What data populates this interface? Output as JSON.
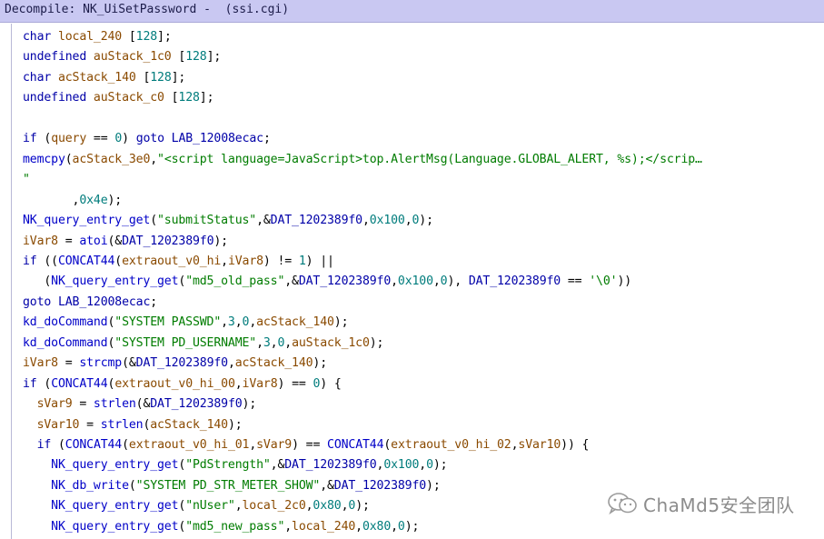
{
  "window": {
    "title": "Decompile: NK_UiSetPassword -  (ssi.cgi)"
  },
  "code": {
    "lines": [
      "char local_240 [128];",
      "undefined auStack_1c0 [128];",
      "char acStack_140 [128];",
      "undefined auStack_c0 [128];",
      "",
      "if (query == 0) goto LAB_12008ecac;",
      "memcpy(acStack_3e0,\"<script language=JavaScript>top.AlertMsg(Language.GLOBAL_ALERT, %s);</scrip…",
      "\"",
      "       ,0x4e);",
      "NK_query_entry_get(\"submitStatus\",&DAT_1202389f0,0x100,0);",
      "iVar8 = atoi(&DAT_1202389f0);",
      "if ((CONCAT44(extraout_v0_hi,iVar8) != 1) ||",
      "   (NK_query_entry_get(\"md5_old_pass\",&DAT_1202389f0,0x100,0), DAT_1202389f0 == '\\0'))",
      "goto LAB_12008ecac;",
      "kd_doCommand(\"SYSTEM PASSWD\",3,0,acStack_140);",
      "kd_doCommand(\"SYSTEM PD_USERNAME\",3,0,auStack_1c0);",
      "iVar8 = strcmp(&DAT_1202389f0,acStack_140);",
      "if (CONCAT44(extraout_v0_hi_00,iVar8) == 0) {",
      "  sVar9 = strlen(&DAT_1202389f0);",
      "  sVar10 = strlen(acStack_140);",
      "  if (CONCAT44(extraout_v0_hi_01,sVar9) == CONCAT44(extraout_v0_hi_02,sVar10)) {",
      "    NK_query_entry_get(\"PdStrength\",&DAT_1202389f0,0x100,0);",
      "    NK_db_write(\"SYSTEM PD_STR_METER_SHOW\",&DAT_1202389f0);",
      "    NK_query_entry_get(\"nUser\",local_2c0,0x80,0);",
      "    NK_query_entry_get(\"md5_new_pass\",local_240,0x80,0);"
    ]
  },
  "watermark": {
    "text": "ChaMd5安全团队",
    "icon": "wechat-icon"
  },
  "colors": {
    "titlebar_bg": "#c9c8f2",
    "keyword": "#0000a8",
    "variable": "#8a4a00",
    "string": "#007c00",
    "number": "#007c7c"
  }
}
